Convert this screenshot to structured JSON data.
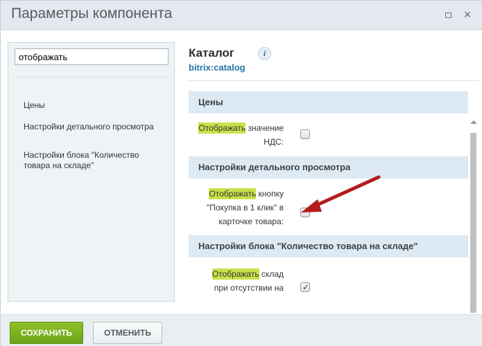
{
  "dialog": {
    "title": "Параметры компонента"
  },
  "left": {
    "search_value": "отображать",
    "nav": [
      "Цены",
      "Настройки детального просмотра",
      "Настройки блока \"Количество товара на складе\""
    ]
  },
  "component": {
    "title": "Каталог",
    "code": "bitrix:catalog",
    "info_glyph": "i"
  },
  "sections": [
    {
      "title": "Цены"
    },
    {
      "title": "Настройки детального просмотра"
    },
    {
      "title": "Настройки блока \"Количество товара на складе\""
    }
  ],
  "options": [
    {
      "highlight": "Отображать",
      "line1_rest": " значение",
      "line2": "НДС:",
      "line3": "",
      "checked": false
    },
    {
      "highlight": "Отображать",
      "line1_rest": " кнопку",
      "line2": "\"Покупка в 1 клик\" в",
      "line3": "карточке товара:",
      "checked": false
    },
    {
      "highlight": "Отображать",
      "line1_rest": " склад",
      "line2": "при отсутствии на",
      "line3": "",
      "checked": true
    }
  ],
  "footer": {
    "save_label": "СОХРАНИТЬ",
    "cancel_label": "ОТМЕНИТЬ"
  },
  "colors": {
    "accent_green": "#7ab51f",
    "highlight": "#c7e24a",
    "arrow_red": "#b31c1c",
    "link_blue": "#2473a8"
  },
  "icons": [
    "info-icon",
    "maximize-icon",
    "close-icon",
    "checkmark-icon",
    "arrow-annotation"
  ]
}
